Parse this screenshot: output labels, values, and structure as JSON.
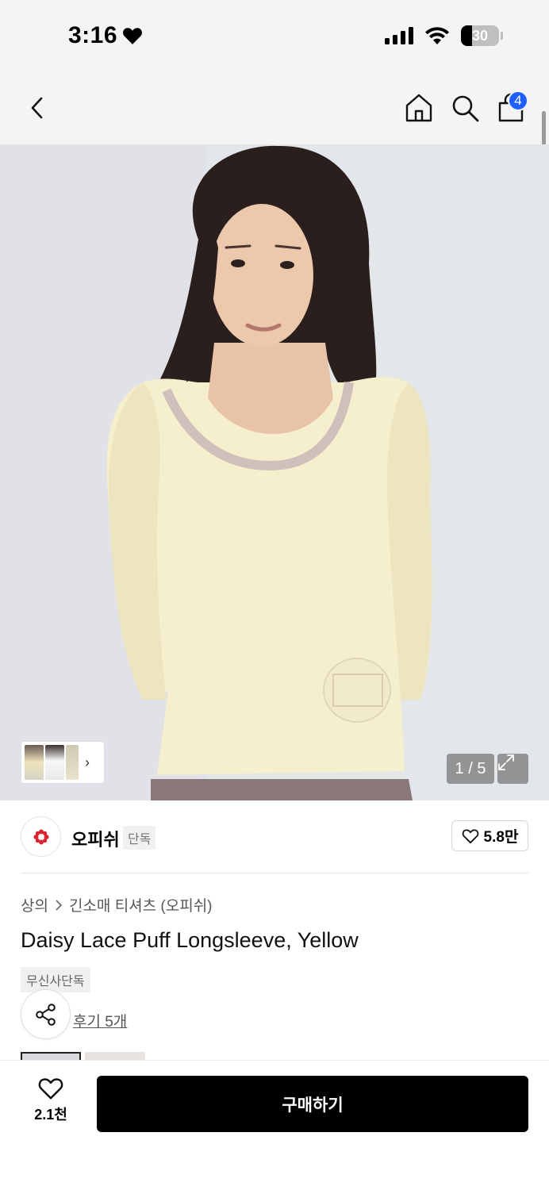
{
  "status_bar": {
    "time": "3:16",
    "battery_level": "30",
    "battery_fraction": 0.3
  },
  "nav": {
    "cart_count": "4",
    "colors": {
      "badge": "#1f5eff",
      "background": "#f4f4f4"
    }
  },
  "gallery": {
    "counter": "1 / 5"
  },
  "brand": {
    "name": "오피쉬",
    "tag": "단독",
    "likes": "5.8만",
    "logo_color": "#d9232e"
  },
  "product": {
    "breadcrumb": [
      "상의",
      "긴소매 티셔츠 (오피쉬)"
    ],
    "title": "Daisy Lace Puff Longsleeve, Yellow",
    "exclusive_label": "무신사단독",
    "review_link": "후기 5개"
  },
  "bottom_bar": {
    "wish_count": "2.1천",
    "buy_label": "구매하기"
  }
}
